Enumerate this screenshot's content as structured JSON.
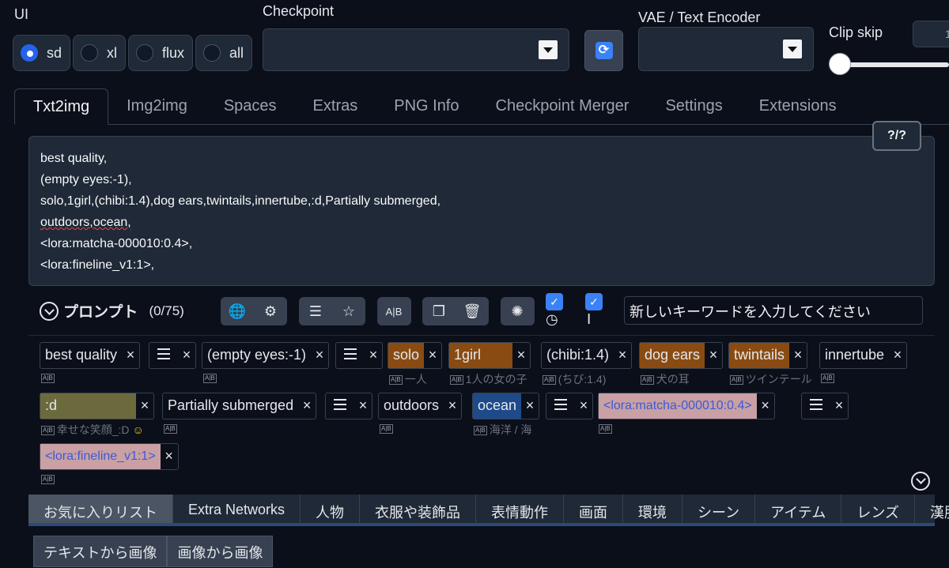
{
  "ui": {
    "label": "UI",
    "options": [
      {
        "label": "sd",
        "selected": true
      },
      {
        "label": "xl",
        "selected": false
      },
      {
        "label": "flux",
        "selected": false
      },
      {
        "label": "all",
        "selected": false
      }
    ]
  },
  "checkpoint": {
    "label": "Checkpoint",
    "value": ""
  },
  "vae": {
    "label": "VAE / Text Encoder",
    "value": ""
  },
  "clip_skip": {
    "label": "Clip skip",
    "value": 1
  },
  "tabs": [
    "Txt2img",
    "Img2img",
    "Spaces",
    "Extras",
    "PNG Info",
    "Checkpoint Merger",
    "Settings",
    "Extensions"
  ],
  "help_button": "?/?",
  "prompt": {
    "lines": [
      "best quality,",
      "(empty eyes:-1),",
      "solo,1girl,(chibi:1.4),dog ears,twintails,innertube,:d,Partially submerged,",
      "outdoors,ocean,",
      "<lora:matcha-000010:0.4>,",
      "<lora:fineline_v1:1>,"
    ]
  },
  "toolbar": {
    "title": "プロンプト",
    "count": "(0/75)",
    "keyword_placeholder": "新しいキーワードを入力してください",
    "ab_icon": "A|B"
  },
  "tags": {
    "t1": "best quality",
    "t2": "(empty eyes:-1)",
    "t3": "solo",
    "t3_tr": "一人",
    "t4": "1girl",
    "t4_tr": "1人の女の子",
    "t5": "(chibi:1.4)",
    "t5_tr": "(ちび:1.4)",
    "t6": "dog ears",
    "t6_tr": "犬の耳",
    "t7": "twintails",
    "t7_tr": "ツインテール",
    "t8": "innertube",
    "t9": ":d",
    "t9_tr": "幸せな笑顔_:D",
    "t10": "Partially submerged",
    "t11": "outdoors",
    "t12": "ocean",
    "t12_tr": "海洋 / 海",
    "t13": "<lora:matcha-000010:0.4>",
    "t14": "<lora:fineline_v1:1>",
    "x": "×"
  },
  "categories": [
    "お気に入りリスト",
    "Extra Networks",
    "人物",
    "衣服や装飾品",
    "表情動作",
    "画面",
    "環境",
    "シーン",
    "アイテム",
    "レンズ",
    "漢服"
  ],
  "subtabs": [
    "テキストから画像",
    "画像から画像"
  ],
  "colors": {
    "bg": "#0b0f19",
    "panel": "#1f2937",
    "accent": "#2563eb",
    "tag_brown": "#8a4b12",
    "tag_olive": "#6b6a3d",
    "tag_blue": "#1e4a8a",
    "tag_pink": "#c9a0a4"
  }
}
